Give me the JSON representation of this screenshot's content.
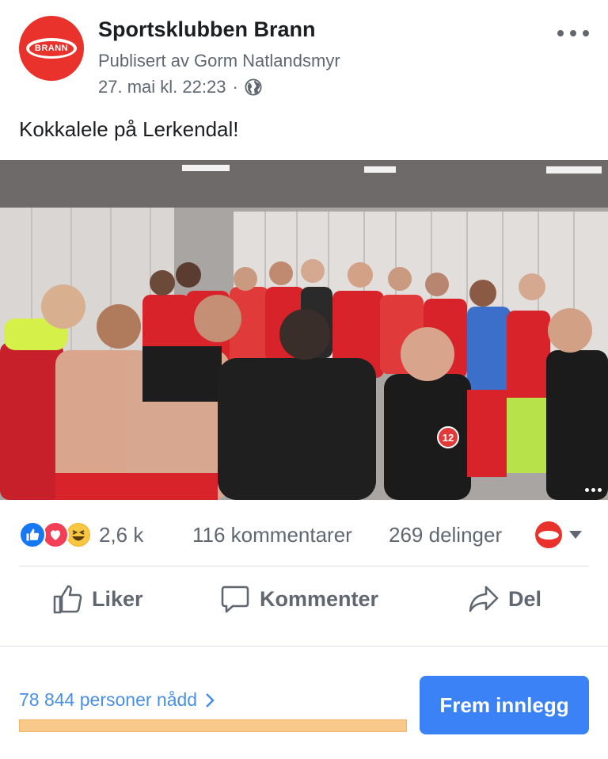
{
  "header": {
    "page_name": "Sportsklubben Brann",
    "publisher": "Publisert av Gorm Natlandsmyr",
    "date": "27. mai kl. 22:23",
    "separator": "·",
    "privacy_icon": "globe-icon",
    "more_icon": "more-horizontal-icon",
    "avatar_text": "BRANN"
  },
  "post": {
    "text": "Kokkalele på Lerkendal!",
    "media": {
      "type": "video",
      "jersey_number": "12"
    }
  },
  "stats": {
    "reactions": [
      "like",
      "love",
      "haha"
    ],
    "reaction_count": "2,6 k",
    "comments": "116 kommentarer",
    "shares": "269 delinger"
  },
  "actions": [
    {
      "label": "Liker",
      "icon": "thumbs-up-icon"
    },
    {
      "label": "Kommenter",
      "icon": "comment-bubble-icon"
    },
    {
      "label": "Del",
      "icon": "share-arrow-icon"
    }
  ],
  "promotion": {
    "reach_text": "78 844 personer nådd",
    "boost_button": "Frem innlegg",
    "progress_fraction": 1.0
  },
  "colors": {
    "brand_red": "#e8322b",
    "link_blue": "#4a90e2",
    "button_blue": "#3b82f6",
    "progress_orange": "#f8c98a"
  }
}
